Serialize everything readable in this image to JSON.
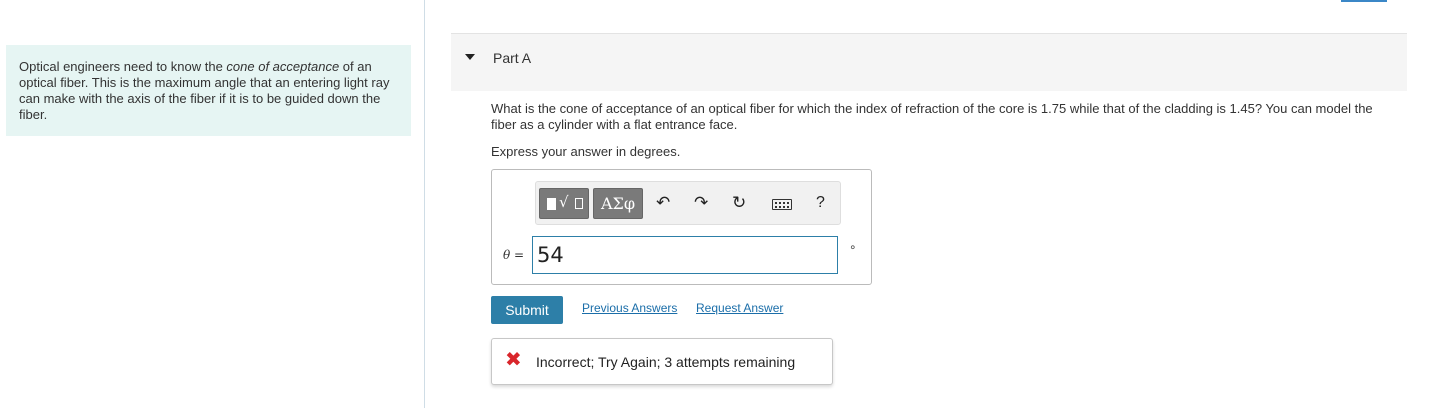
{
  "intro": {
    "text_before": "Optical engineers need to know the ",
    "text_emphasis": "cone of acceptance",
    "text_after": " of an optical fiber. This is the maximum angle that an entering light ray can make with the axis of the fiber if it is to be guided down the fiber."
  },
  "part": {
    "title": "Part A",
    "caret_icon": "caret-down-icon"
  },
  "question": {
    "text": "What is the cone of acceptance of an optical fiber for which the index of refraction of the core is 1.75 while that of the cladding is 1.45? You can model the fiber as a cylinder with a flat entrance face.",
    "instruction": "Express your answer in degrees."
  },
  "toolbar": {
    "templates_icon": "templates-icon",
    "symbols_label": "ΑΣφ",
    "undo_icon": "undo-icon",
    "redo_icon": "redo-icon",
    "reset_icon": "reset-icon",
    "keyboard_icon": "keyboard-icon",
    "help_label": "?"
  },
  "answer": {
    "variable_symbol": "θ",
    "equals": " =",
    "value": "54",
    "unit": "∘"
  },
  "actions": {
    "submit_label": "Submit",
    "previous_answers": "Previous Answers",
    "request_answer": "Request Answer"
  },
  "feedback": {
    "icon": "incorrect-x-icon",
    "text": "Incorrect; Try Again; 3 attempts remaining",
    "color": "#d9262b"
  },
  "colors": {
    "accent": "#2d7fa8",
    "intro_bg": "#e6f5f3",
    "link": "#1b6ea9"
  }
}
